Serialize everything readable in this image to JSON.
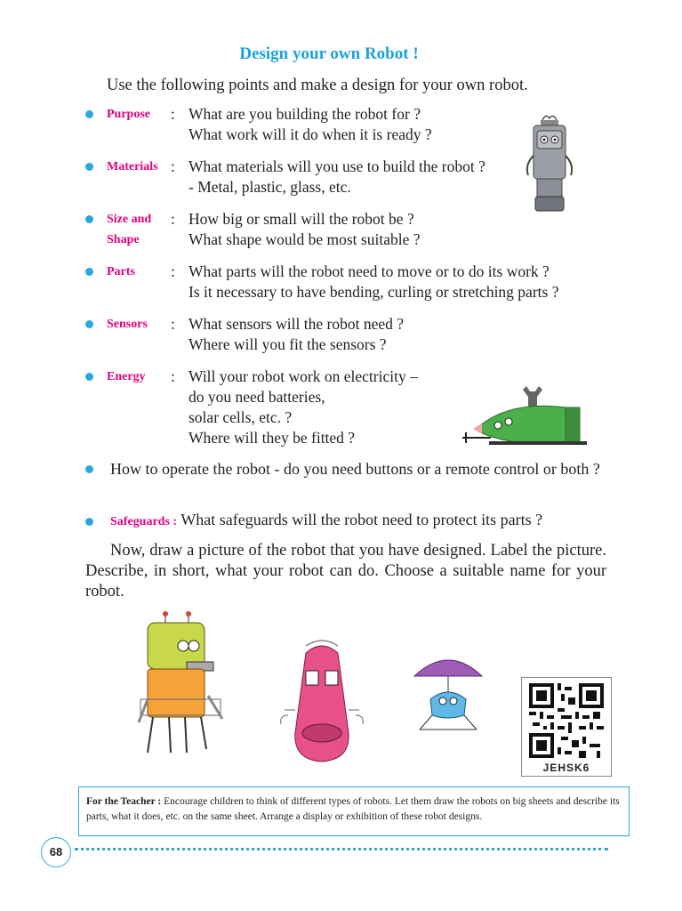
{
  "title": "Design your own Robot !",
  "intro": "Use the following points and make a design for your own robot.",
  "points": [
    {
      "label": "Purpose",
      "lines": [
        "What are you building the robot for ?",
        "What work will it do when it is ready ?"
      ]
    },
    {
      "label": "Materials",
      "lines": [
        "What materials will you use to build the robot ?",
        "- Metal, plastic, glass, etc."
      ]
    },
    {
      "label": "Size and Shape",
      "lines": [
        "How big or small will the robot be ?",
        "What shape would be most suitable ?"
      ]
    },
    {
      "label": "Parts",
      "lines": [
        "What parts will the robot need to move or to do its work ?",
        "Is it necessary to have bending, curling or stretching parts ?"
      ]
    },
    {
      "label": "Sensors",
      "lines": [
        "What sensors will the robot need ?",
        "Where will you fit the sensors ?"
      ]
    },
    {
      "label": "Energy",
      "lines": [
        "Will your robot work on electricity –",
        "do you need batteries,",
        "solar cells, etc. ?",
        "Where will they be fitted ?"
      ]
    }
  ],
  "operate_point": "How to operate the robot - do you need buttons or a remote control or both ?",
  "safeguard_point": {
    "label": "Safeguards :",
    "text": "What safeguards will the robot need to protect its parts ?"
  },
  "paragraph": "Now, draw a picture of the robot that you have designed. Label the picture. Describe, in short, what your robot can do. Choose a suitable name for your robot.",
  "teacher_note": {
    "label": "For the Teacher :",
    "text": "Encourage children to think of different types of robots. Let them draw the robots on big sheets and describe its parts, what it does, etc. on the same sheet. Arrange a display or exhibition of these robot designs."
  },
  "qr_caption": "JEHSK6",
  "page_number": "68",
  "colors": {
    "title": "#1aa3dc",
    "label": "#e4007f",
    "bullet": "#29a7df"
  }
}
